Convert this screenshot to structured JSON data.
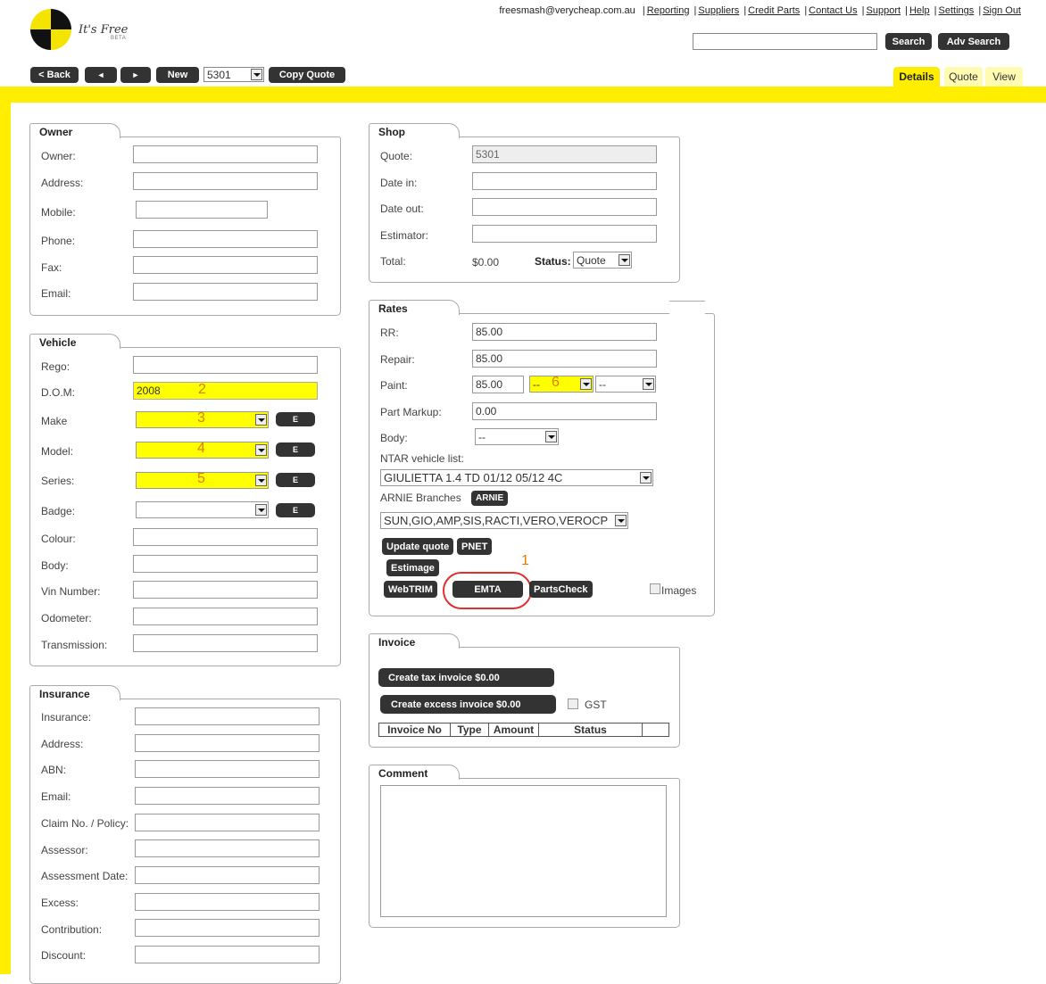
{
  "header": {
    "logo_text": "It's Free",
    "logo_beta": "BETA",
    "user_email": "freesmash@verycheap.com.au",
    "links": [
      "Reporting",
      "Suppliers",
      "Credit Parts",
      "Contact Us",
      "Support",
      "Help",
      "Settings",
      "Sign Out"
    ],
    "search_value": "",
    "search_label": "Search",
    "adv_search_label": "Adv Search"
  },
  "nav": {
    "back_label": "< Back",
    "prev_label": "◄",
    "next_label": "►",
    "new_label": "New",
    "quote_select": "5301",
    "copy_quote_label": "Copy Quote"
  },
  "tabs": [
    "Details",
    "Quote",
    "View"
  ],
  "owner": {
    "title": "Owner",
    "fields": [
      {
        "label": "Owner:",
        "value": ""
      },
      {
        "label": "Address:",
        "value": ""
      },
      {
        "label": "Mobile:",
        "value": ""
      },
      {
        "label": "Phone:",
        "value": ""
      },
      {
        "label": "Fax:",
        "value": ""
      },
      {
        "label": "Email:",
        "value": ""
      }
    ]
  },
  "vehicle": {
    "title": "Vehicle",
    "rego_label": "Rego:",
    "rego": "",
    "dom_label": "D.O.M:",
    "dom": "2008",
    "dom_marker": "2",
    "make_label": "Make",
    "make_marker": "3",
    "model_label": "Model:",
    "model_marker": "4",
    "series_label": "Series:",
    "series_marker": "5",
    "badge_label": "Badge:",
    "e_label": "E",
    "colour_label": "Colour:",
    "body_label": "Body:",
    "vin_label": "Vin Number:",
    "odometer_label": "Odometer:",
    "transmission_label": "Transmission:"
  },
  "insurance": {
    "title": "Insurance",
    "fields": [
      "Insurance:",
      "Address:",
      "ABN:",
      "Email:",
      "Claim No. / Policy:",
      "Assessor:",
      "Assessment Date:",
      "Excess:",
      "Contribution:",
      "Discount:"
    ]
  },
  "shop": {
    "title": "Shop",
    "quote_label": "Quote:",
    "quote": "5301",
    "date_in_label": "Date in:",
    "date_out_label": "Date out:",
    "estimator_label": "Estimator:",
    "total_label": "Total:",
    "total": "$0.00",
    "status_label": "Status:",
    "status": "Quote"
  },
  "rates": {
    "title": "Rates",
    "rr_label": "RR:",
    "rr": "85.00",
    "repair_label": "Repair:",
    "repair": "85.00",
    "paint_label": "Paint:",
    "paint": "85.00",
    "paint_sel1": "--",
    "paint_marker": "6",
    "paint_sel2": "--",
    "markup_label": "Part Markup:",
    "markup": "0.00",
    "body_label": "Body:",
    "body": "--",
    "ntar_label": "NTAR vehicle list:",
    "ntar_value": "GIULIETTA 1.4 TD 01/12 05/12 4C",
    "arnie_label": "ARNIE Branches",
    "arnie_button": "ARNIE",
    "arnie_value": "SUN,GIO,AMP,SIS,RACTI,VERO,VEROCP",
    "buttons": {
      "update": "Update quote",
      "pnet": "PNET",
      "estimage": "Estimage",
      "webtrim": "WebTRIM",
      "emta": "EMTA",
      "partscheck": "PartsCheck"
    },
    "emta_marker": "1",
    "images_label": "Images"
  },
  "invoice": {
    "title": "Invoice",
    "tax_button": "Create tax invoice $0.00",
    "excess_button": "Create excess invoice $0.00",
    "gst_label": "GST",
    "columns": [
      "Invoice No",
      "Type",
      "Amount",
      "Status"
    ]
  },
  "comment": {
    "title": "Comment",
    "value": ""
  }
}
